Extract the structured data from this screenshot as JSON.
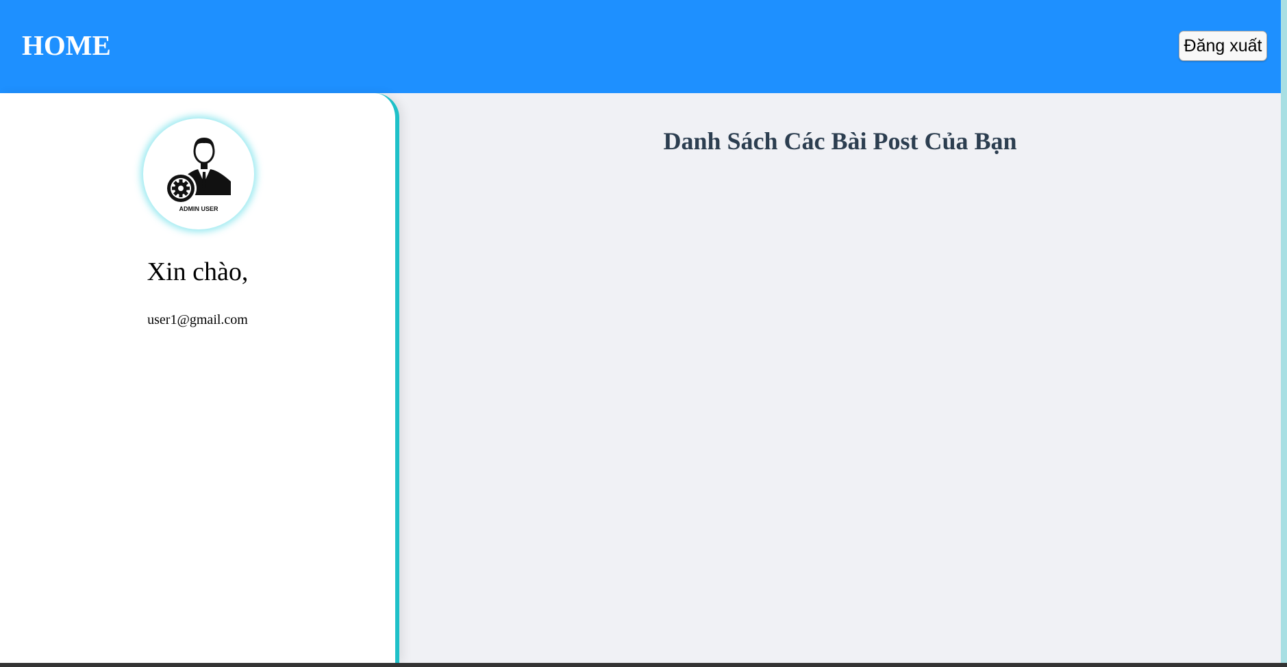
{
  "header": {
    "title": "HOME",
    "logout_label": "Đăng xuất",
    "background_color": "#1e90ff"
  },
  "sidebar": {
    "avatar": {
      "icon": "admin-user-icon",
      "caption": "ADMIN USER"
    },
    "greeting": "Xin chào,",
    "email": "user1@gmail.com",
    "accent_color": "#1ec0c8"
  },
  "main": {
    "title": "Danh Sách Các Bài Post Của Bạn",
    "posts": []
  }
}
